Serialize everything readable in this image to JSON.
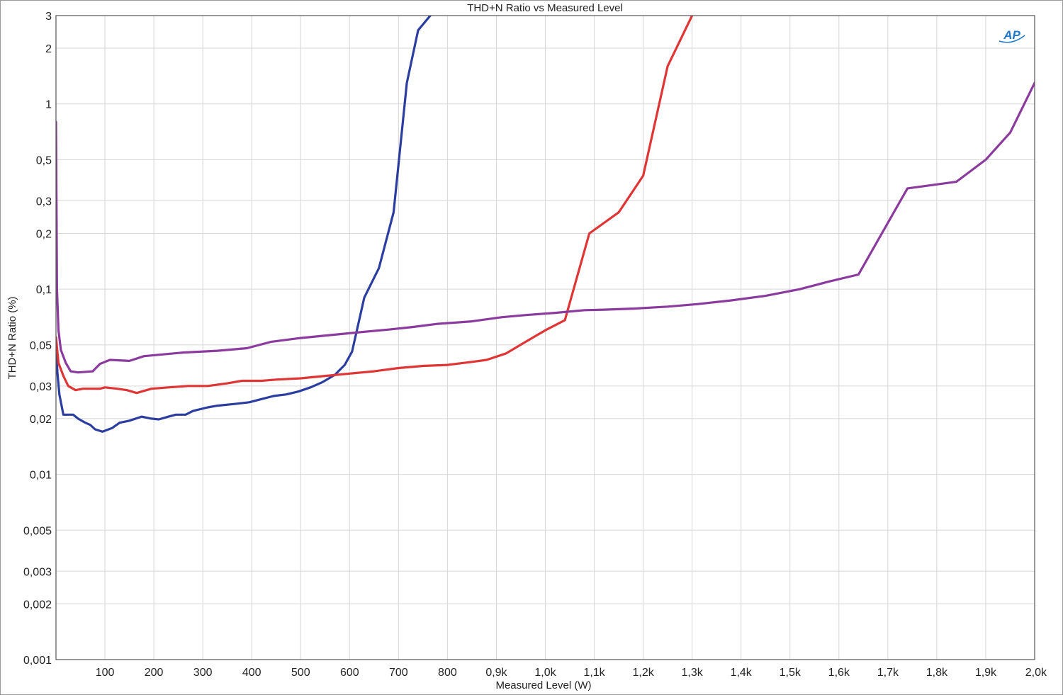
{
  "chart_data": {
    "type": "line",
    "title": "THD+N Ratio vs Measured Level",
    "xlabel": "Measured Level (W)",
    "ylabel": "THD+N Ratio (%)",
    "xlim": [
      0,
      2000
    ],
    "ylim": [
      0.001,
      3
    ],
    "yscale": "log",
    "grid": true,
    "x_ticks": [
      {
        "v": 100,
        "label": "100"
      },
      {
        "v": 200,
        "label": "200"
      },
      {
        "v": 300,
        "label": "300"
      },
      {
        "v": 400,
        "label": "400"
      },
      {
        "v": 500,
        "label": "500"
      },
      {
        "v": 600,
        "label": "600"
      },
      {
        "v": 700,
        "label": "700"
      },
      {
        "v": 800,
        "label": "800"
      },
      {
        "v": 900,
        "label": "0,9k"
      },
      {
        "v": 1000,
        "label": "1,0k"
      },
      {
        "v": 1100,
        "label": "1,1k"
      },
      {
        "v": 1200,
        "label": "1,2k"
      },
      {
        "v": 1300,
        "label": "1,3k"
      },
      {
        "v": 1400,
        "label": "1,4k"
      },
      {
        "v": 1500,
        "label": "1,5k"
      },
      {
        "v": 1600,
        "label": "1,6k"
      },
      {
        "v": 1700,
        "label": "1,7k"
      },
      {
        "v": 1800,
        "label": "1,8k"
      },
      {
        "v": 1900,
        "label": "1,9k"
      },
      {
        "v": 2000,
        "label": "2,0k"
      }
    ],
    "y_ticks": [
      {
        "v": 3,
        "label": "3"
      },
      {
        "v": 2,
        "label": "2"
      },
      {
        "v": 1,
        "label": "1"
      },
      {
        "v": 0.5,
        "label": "0,5"
      },
      {
        "v": 0.3,
        "label": "0,3"
      },
      {
        "v": 0.2,
        "label": "0,2"
      },
      {
        "v": 0.1,
        "label": "0,1"
      },
      {
        "v": 0.05,
        "label": "0,05"
      },
      {
        "v": 0.03,
        "label": "0,03"
      },
      {
        "v": 0.02,
        "label": "0,02"
      },
      {
        "v": 0.01,
        "label": "0,01"
      },
      {
        "v": 0.005,
        "label": "0,005"
      },
      {
        "v": 0.003,
        "label": "0,003"
      },
      {
        "v": 0.002,
        "label": "0,002"
      },
      {
        "v": 0.001,
        "label": "0,001"
      }
    ],
    "series": [
      {
        "color": "#2b3ea0",
        "points": [
          [
            0,
            0.05
          ],
          [
            3,
            0.035
          ],
          [
            7,
            0.027
          ],
          [
            15,
            0.021
          ],
          [
            35,
            0.021
          ],
          [
            45,
            0.02
          ],
          [
            60,
            0.019
          ],
          [
            70,
            0.0185
          ],
          [
            80,
            0.0175
          ],
          [
            95,
            0.017
          ],
          [
            115,
            0.0178
          ],
          [
            130,
            0.019
          ],
          [
            150,
            0.0195
          ],
          [
            175,
            0.0205
          ],
          [
            195,
            0.02
          ],
          [
            210,
            0.0198
          ],
          [
            230,
            0.0205
          ],
          [
            245,
            0.021
          ],
          [
            265,
            0.021
          ],
          [
            280,
            0.022
          ],
          [
            310,
            0.023
          ],
          [
            330,
            0.0235
          ],
          [
            365,
            0.024
          ],
          [
            395,
            0.0245
          ],
          [
            420,
            0.0255
          ],
          [
            445,
            0.0265
          ],
          [
            470,
            0.027
          ],
          [
            495,
            0.028
          ],
          [
            520,
            0.0295
          ],
          [
            545,
            0.0315
          ],
          [
            570,
            0.0345
          ],
          [
            590,
            0.039
          ],
          [
            605,
            0.046
          ],
          [
            630,
            0.09
          ],
          [
            660,
            0.13
          ],
          [
            690,
            0.26
          ],
          [
            717,
            1.3
          ],
          [
            740,
            2.5
          ],
          [
            765,
            3.0
          ]
        ]
      },
      {
        "color": "#e03535",
        "points": [
          [
            0,
            0.055
          ],
          [
            5,
            0.04
          ],
          [
            15,
            0.034
          ],
          [
            25,
            0.03
          ],
          [
            40,
            0.0285
          ],
          [
            55,
            0.029
          ],
          [
            90,
            0.029
          ],
          [
            100,
            0.0295
          ],
          [
            125,
            0.029
          ],
          [
            145,
            0.0285
          ],
          [
            165,
            0.0275
          ],
          [
            195,
            0.029
          ],
          [
            230,
            0.0295
          ],
          [
            270,
            0.03
          ],
          [
            310,
            0.03
          ],
          [
            350,
            0.031
          ],
          [
            380,
            0.032
          ],
          [
            420,
            0.032
          ],
          [
            450,
            0.0325
          ],
          [
            500,
            0.033
          ],
          [
            550,
            0.034
          ],
          [
            600,
            0.035
          ],
          [
            650,
            0.036
          ],
          [
            700,
            0.0375
          ],
          [
            750,
            0.0385
          ],
          [
            800,
            0.039
          ],
          [
            850,
            0.0405
          ],
          [
            880,
            0.0415
          ],
          [
            920,
            0.045
          ],
          [
            960,
            0.052
          ],
          [
            1000,
            0.06
          ],
          [
            1040,
            0.068
          ],
          [
            1090,
            0.2
          ],
          [
            1150,
            0.26
          ],
          [
            1200,
            0.41
          ],
          [
            1250,
            1.6
          ],
          [
            1300,
            3.0
          ]
        ]
      },
      {
        "color": "#8b3a9e",
        "points": [
          [
            0,
            0.8
          ],
          [
            2,
            0.1
          ],
          [
            5,
            0.06
          ],
          [
            10,
            0.047
          ],
          [
            20,
            0.04
          ],
          [
            30,
            0.036
          ],
          [
            45,
            0.0355
          ],
          [
            75,
            0.036
          ],
          [
            90,
            0.0395
          ],
          [
            110,
            0.0415
          ],
          [
            150,
            0.041
          ],
          [
            180,
            0.0435
          ],
          [
            260,
            0.0455
          ],
          [
            330,
            0.0465
          ],
          [
            390,
            0.048
          ],
          [
            440,
            0.052
          ],
          [
            500,
            0.0545
          ],
          [
            560,
            0.0565
          ],
          [
            620,
            0.0585
          ],
          [
            680,
            0.0605
          ],
          [
            730,
            0.0625
          ],
          [
            780,
            0.065
          ],
          [
            850,
            0.067
          ],
          [
            910,
            0.0705
          ],
          [
            960,
            0.0725
          ],
          [
            1020,
            0.0745
          ],
          [
            1080,
            0.077
          ],
          [
            1120,
            0.0775
          ],
          [
            1180,
            0.0785
          ],
          [
            1250,
            0.0805
          ],
          [
            1310,
            0.083
          ],
          [
            1380,
            0.087
          ],
          [
            1450,
            0.092
          ],
          [
            1520,
            0.1
          ],
          [
            1580,
            0.11
          ],
          [
            1640,
            0.12
          ],
          [
            1740,
            0.35
          ],
          [
            1840,
            0.38
          ],
          [
            1900,
            0.5
          ],
          [
            1950,
            0.7
          ],
          [
            2000,
            1.3
          ]
        ]
      }
    ]
  },
  "logo": {
    "text": "AP"
  }
}
